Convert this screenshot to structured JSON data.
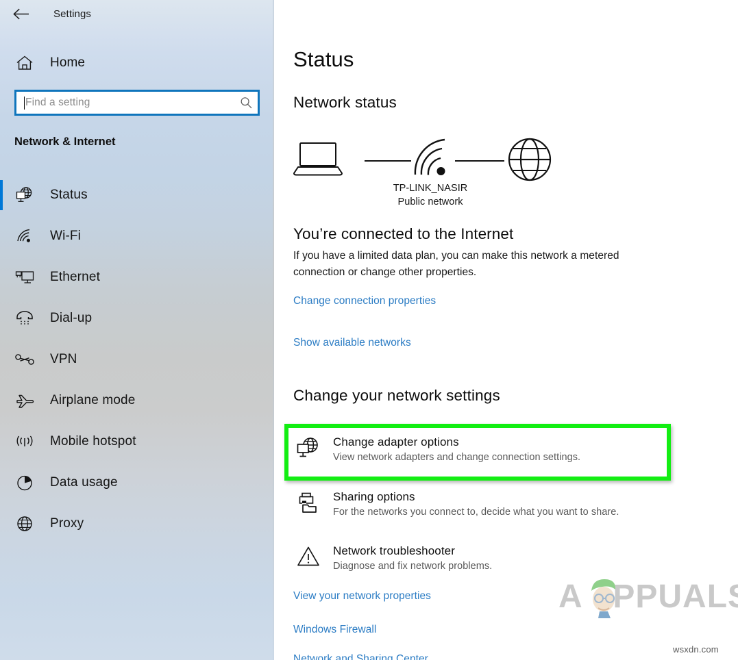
{
  "window": {
    "app_title": "Settings"
  },
  "sidebar": {
    "back_icon": "back-arrow-icon",
    "home": {
      "label": "Home",
      "icon": "home-icon"
    },
    "search": {
      "placeholder": "Find a setting",
      "value": "",
      "icon": "search-icon"
    },
    "section_title": "Network & Internet",
    "items": [
      {
        "label": "Status",
        "icon": "globe-monitor-icon",
        "selected": true
      },
      {
        "label": "Wi-Fi",
        "icon": "wifi-icon",
        "selected": false
      },
      {
        "label": "Ethernet",
        "icon": "ethernet-icon",
        "selected": false
      },
      {
        "label": "Dial-up",
        "icon": "dialup-phone-icon",
        "selected": false
      },
      {
        "label": "VPN",
        "icon": "vpn-key-icon",
        "selected": false
      },
      {
        "label": "Airplane mode",
        "icon": "airplane-icon",
        "selected": false
      },
      {
        "label": "Mobile hotspot",
        "icon": "hotspot-icon",
        "selected": false
      },
      {
        "label": "Data usage",
        "icon": "pie-chart-icon",
        "selected": false
      },
      {
        "label": "Proxy",
        "icon": "globe-icon",
        "selected": false
      }
    ]
  },
  "main": {
    "page_title": "Status",
    "network_status_heading": "Network status",
    "diagram": {
      "device_icon": "laptop-icon",
      "connection_icon": "wifi-icon",
      "internet_icon": "globe-icon",
      "ssid": "TP-LINK_NASIR",
      "network_type": "Public network"
    },
    "connected_title": "You’re connected to the Internet",
    "connected_desc": "If you have a limited data plan, you can make this network a metered connection or change other properties.",
    "links_top": [
      {
        "label": "Change connection properties"
      },
      {
        "label": "Show available networks"
      }
    ],
    "change_settings_heading": "Change your network settings",
    "settings_rows": [
      {
        "title": "Change adapter options",
        "subtitle": "View network adapters and change connection settings.",
        "icon": "network-adapter-icon",
        "highlighted": true
      },
      {
        "title": "Sharing options",
        "subtitle": "For the networks you connect to, decide what you want to share.",
        "icon": "printer-folder-share-icon",
        "highlighted": false
      },
      {
        "title": "Network troubleshooter",
        "subtitle": "Diagnose and fix network problems.",
        "icon": "warning-triangle-icon",
        "highlighted": false
      }
    ],
    "links_bottom": [
      {
        "label": "View your network properties"
      },
      {
        "label": "Windows Firewall"
      },
      {
        "label": "Network and Sharing Center"
      }
    ]
  },
  "watermarks": {
    "appuals": "PPUALS",
    "appuals_first_letter": "A",
    "wsxdn": "wsxdn.com"
  },
  "colors": {
    "accent_blue": "#0078d7",
    "link_blue": "#2b7cc4",
    "highlight_green": "#13ee13",
    "search_border": "#0f75bc"
  }
}
